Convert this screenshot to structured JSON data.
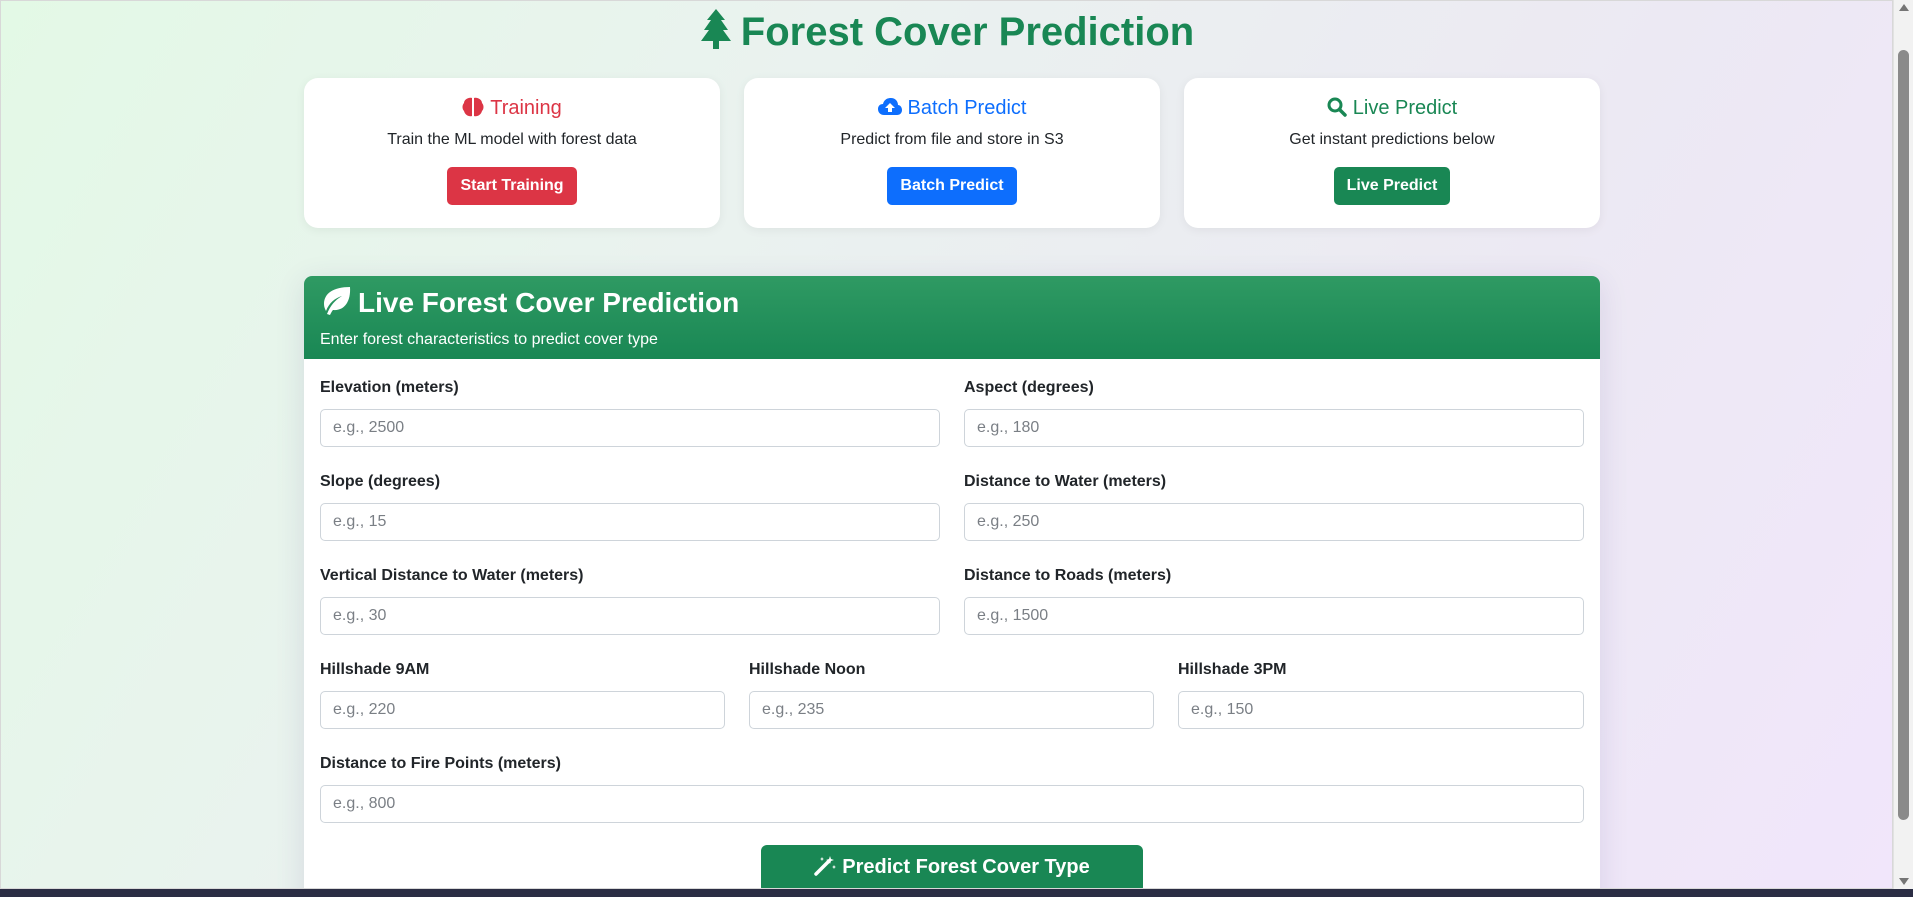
{
  "page": {
    "title": "Forest Cover Prediction",
    "title_icon": "tree-icon"
  },
  "cards": [
    {
      "title": "Training",
      "icon": "brain-icon",
      "description": "Train the ML model with forest data",
      "button": "Start Training",
      "color": "#dc3545"
    },
    {
      "title": "Batch Predict",
      "icon": "cloud-upload-icon",
      "description": "Predict from file and store in S3",
      "button": "Batch Predict",
      "color": "#0d6efd"
    },
    {
      "title": "Live Predict",
      "icon": "search-icon",
      "description": "Get instant predictions below",
      "button": "Live Predict",
      "color": "#198754"
    }
  ],
  "form": {
    "title": "Live Forest Cover Prediction",
    "title_icon": "leaf-icon",
    "subtitle": "Enter forest characteristics to predict cover type",
    "fields": {
      "elevation": {
        "label": "Elevation (meters)",
        "placeholder": "e.g., 2500",
        "value": ""
      },
      "aspect": {
        "label": "Aspect (degrees)",
        "placeholder": "e.g., 180",
        "value": ""
      },
      "slope": {
        "label": "Slope (degrees)",
        "placeholder": "e.g., 15",
        "value": ""
      },
      "distance_to_water": {
        "label": "Distance to Water (meters)",
        "placeholder": "e.g., 250",
        "value": ""
      },
      "vertical_distance_to_water": {
        "label": "Vertical Distance to Water (meters)",
        "placeholder": "e.g., 30",
        "value": ""
      },
      "distance_to_roads": {
        "label": "Distance to Roads (meters)",
        "placeholder": "e.g., 1500",
        "value": ""
      },
      "hillshade_9am": {
        "label": "Hillshade 9AM",
        "placeholder": "e.g., 220",
        "value": ""
      },
      "hillshade_noon": {
        "label": "Hillshade Noon",
        "placeholder": "e.g., 235",
        "value": ""
      },
      "hillshade_3pm": {
        "label": "Hillshade 3PM",
        "placeholder": "e.g., 150",
        "value": ""
      },
      "distance_to_fire_points": {
        "label": "Distance to Fire Points (meters)",
        "placeholder": "e.g., 800",
        "value": ""
      }
    },
    "submit_label": "Predict Forest Cover Type",
    "submit_icon": "magic-wand-icon"
  },
  "colors": {
    "primary_green": "#198754",
    "danger_red": "#dc3545",
    "primary_blue": "#0d6efd"
  }
}
